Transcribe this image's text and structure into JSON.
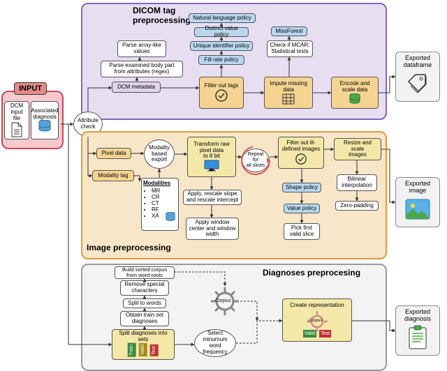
{
  "sections": {
    "input": {
      "title": "INPUT"
    },
    "dicom": {
      "title": "DICOM tag\npreprocessing"
    },
    "image": {
      "title": "Image preprocessing"
    },
    "diag": {
      "title": "Diagnoses preprocesing"
    }
  },
  "input_block": {
    "dcm_label": "DCM\ninput file",
    "assoc_label": "Associated\ndiagnosis"
  },
  "attribute_check": "Attribute\ncheck",
  "dicom_nodes": {
    "dcm_meta": "DCM metadata",
    "parse_body": "Parse examined body part\nfrom attributes (regex)",
    "parse_arr": "Parse array-like\nvalues",
    "filter_tags": "Filter out tags",
    "nat_lang": "Natural language policy",
    "distinct": "Distinct value policy",
    "unique": "Unique identifier policy",
    "fill": "Fill rate policy",
    "impute": "Impute missing\ndata",
    "mcar": "Check if MCAR:\nStatistical tests",
    "missforest": "MissForest",
    "encode": "Encode and\nscale data"
  },
  "image_nodes": {
    "pixel": "Pixel data",
    "modality_tag": "Modality tag",
    "modality_export": "Modality\nbased\nexport",
    "modalities_hdr": "Modalities",
    "modalities": [
      "MR",
      "CR",
      "CT",
      "RF",
      "XA"
    ],
    "transform8": "Transform raw\npixel data\nto 8 bit",
    "rescale": "Apply, rescale slope\nand rescale intercept",
    "window": "Apply window\ncenter and window\nwidth",
    "repeat": "Repeat for\nall slices",
    "filter_img": "Filter out ill-\ndefined images",
    "shape_pol": "Shape policy",
    "value_pol": "Value policy",
    "pick_first": "Pick first\nvalid slice",
    "resize": "Resize and scale\nimages",
    "bilinear": "Bilinear\ninterpolation",
    "zero_pad": "Zero-padding"
  },
  "diag_nodes": {
    "split_sets": "Split diagnoses into\nsets",
    "obtain_train": "Obtain train set\ndiagnoses",
    "split_words": "Split to words",
    "remove_spec": "Remove special\ncharacters",
    "build_corpus": "Build sorted corpus\nfrom word roots",
    "sel_min": "Select\nminumum word\nfrequency",
    "corpus_label": "Corpus",
    "create_rep": "Create representation"
  },
  "outputs": {
    "dataframe": "Exported\ndataframe",
    "image": "Exported\nimage",
    "diagnosis": "Exported\ndiagnosis"
  },
  "split_tags": {
    "train": "Train",
    "valid": "Valid",
    "test": "Test"
  }
}
